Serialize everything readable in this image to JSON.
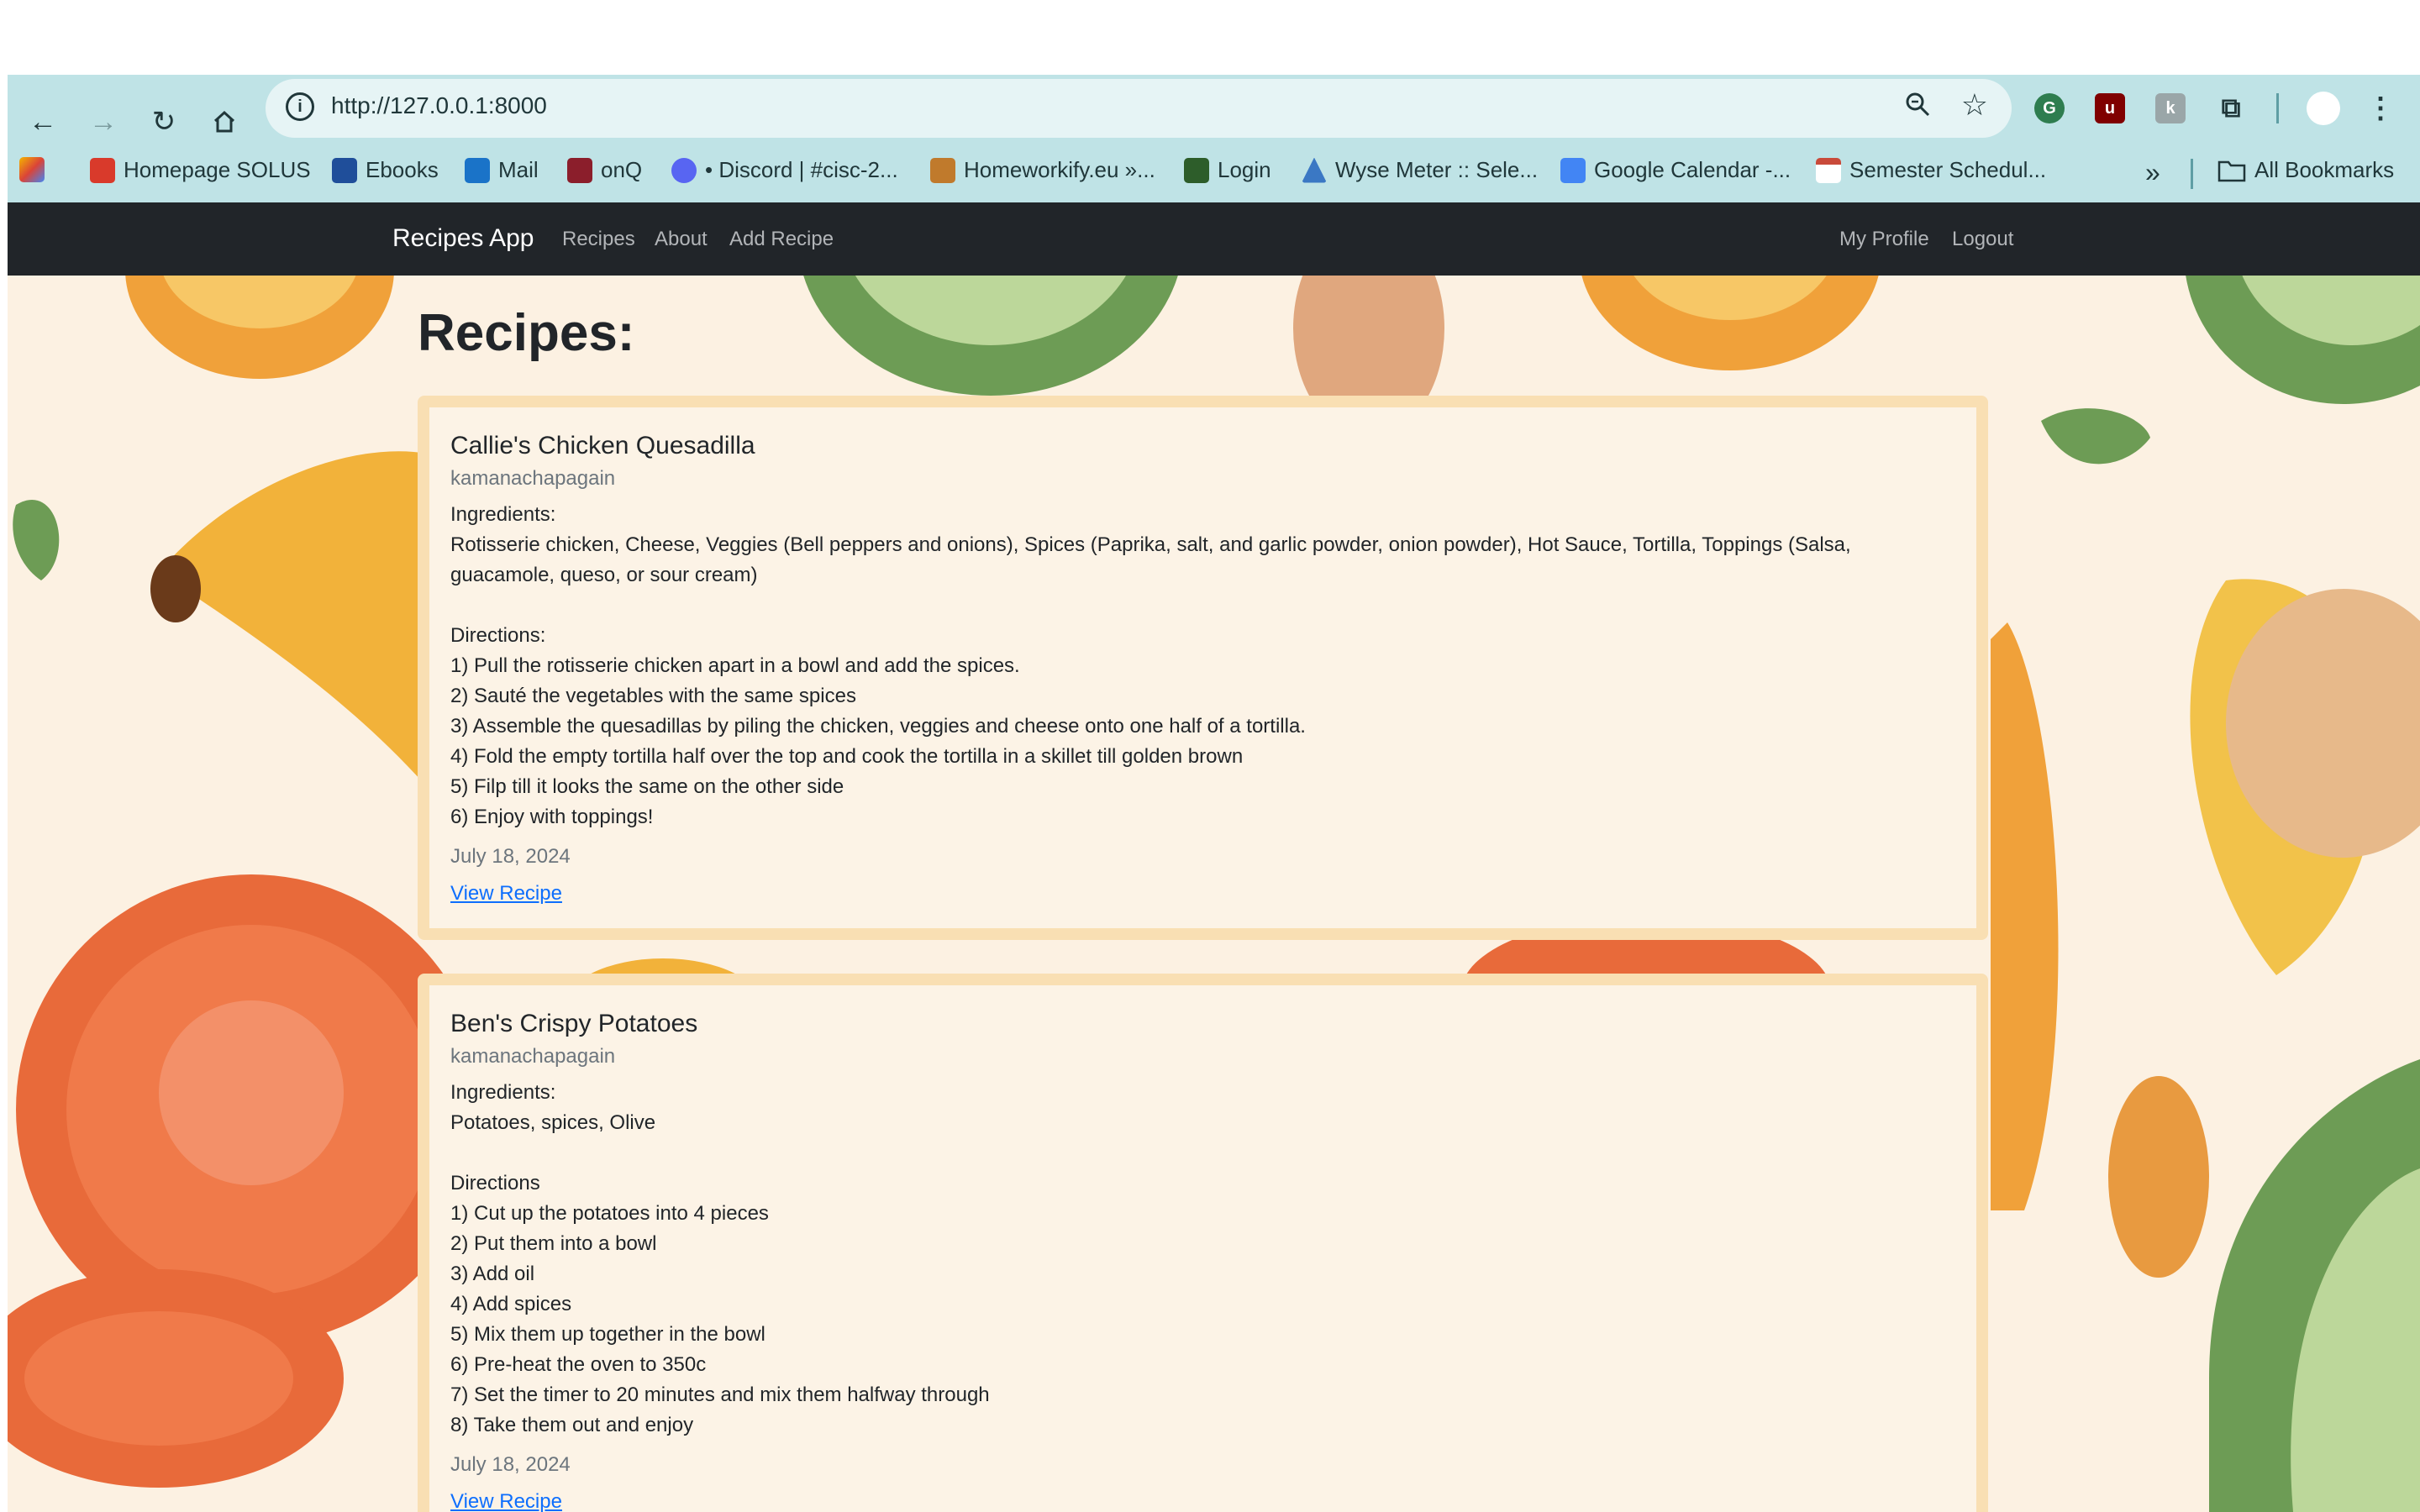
{
  "browser": {
    "url": "http://127.0.0.1:8000",
    "bookmarks": [
      {
        "label": "Homepage SOLUS",
        "color": "#d93a2b"
      },
      {
        "label": "Ebooks",
        "color": "#1f4e9a"
      },
      {
        "label": "Mail",
        "color": "#1a73c8"
      },
      {
        "label": "onQ",
        "color": "#8b1e2b"
      },
      {
        "label": "• Discord | #cisc-2...",
        "color": "#5865f2"
      },
      {
        "label": "Homeworkify.eu »...",
        "color": "#c07a2c"
      },
      {
        "label": "Login",
        "color": "#2d5d2a"
      },
      {
        "label": "Wyse Meter :: Sele...",
        "color": "#3b78c4"
      },
      {
        "label": "Google Calendar -...",
        "color": "#4285f4"
      },
      {
        "label": "Semester Schedul...",
        "color": "#c94a3a"
      }
    ],
    "all_bookmarks": "All Bookmarks",
    "more_icon": "double-chevron-right-icon"
  },
  "navbar": {
    "brand": "Recipes App",
    "links": [
      "Recipes",
      "About",
      "Add Recipe"
    ],
    "right_links": [
      "My Profile",
      "Logout"
    ]
  },
  "page": {
    "heading": "Recipes:"
  },
  "recipes": [
    {
      "title": "Callie's Chicken Quesadilla",
      "author": "kamanachapagain",
      "body": "Ingredients:\nRotisserie chicken, Cheese, Veggies (Bell peppers and onions), Spices (Paprika, salt, and garlic powder, onion powder), Hot Sauce, Tortilla, Toppings (Salsa, guacamole, queso, or sour cream)\n\nDirections:\n1) Pull the rotisserie chicken apart in a bowl and add the spices.\n2) Sauté the vegetables with the same spices\n3) Assemble the quesadillas by piling the chicken, veggies and cheese onto one half of a tortilla.\n4) Fold the empty tortilla half over the top and cook the tortilla in a skillet till golden brown\n5) Filp till it looks the same on the other side\n6) Enjoy with toppings!",
      "date": "July 18, 2024",
      "link": "View Recipe"
    },
    {
      "title": "Ben's Crispy Potatoes",
      "author": "kamanachapagain",
      "body": "Ingredients:\nPotatoes, spices, Olive\n\nDirections\n1) Cut up the potatoes into 4 pieces\n2) Put them into a bowl\n3) Add oil\n4) Add spices\n5) Mix them up together in the bowl\n6) Pre-heat the oven to 350c\n7) Set the timer to 20 minutes and mix them halfway through\n8) Take them out and enjoy",
      "date": "July 18, 2024",
      "link": "View Recipe"
    }
  ],
  "colors": {
    "navbar_bg": "#212529",
    "page_bg": "#fcf1e2",
    "card_border": "#f9dfb3",
    "link": "#0d6efd"
  }
}
